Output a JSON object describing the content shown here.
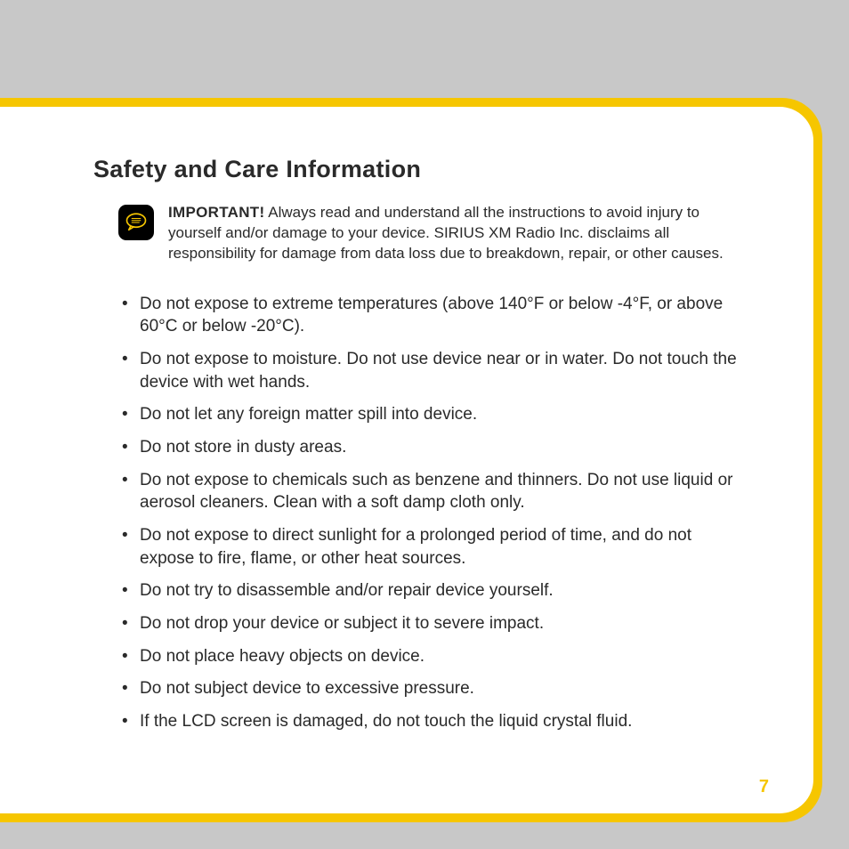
{
  "heading": "Safety and Care Information",
  "important": {
    "label": "IMPORTANT!",
    "text": " Always read and understand all the instructions to avoid injury to yourself and/or damage to your device. SIRIUS XM Radio Inc. disclaims all responsibility for damage from data loss due to breakdown, repair, or other causes."
  },
  "bullets": [
    "Do not expose to extreme temperatures (above 140°F or below -4°F, or above 60°C or below -20°C).",
    "Do not expose to moisture. Do not use device near or in water. Do not touch the device with wet hands.",
    "Do not let any foreign matter spill into device.",
    "Do not store in dusty areas.",
    "Do not expose to chemicals such as benzene and thinners. Do not use liquid or aerosol cleaners. Clean with a soft damp cloth only.",
    "Do not expose to direct sunlight for a prolonged period of time, and do not expose to fire, flame, or other heat sources.",
    "Do not try to disassemble and/or repair device yourself.",
    "Do not drop your device or subject it to severe impact.",
    "Do not place heavy objects on device.",
    "Do not subject device to excessive pressure.",
    "If the LCD screen is damaged, do not touch the liquid crystal fluid."
  ],
  "pageNumber": "7"
}
